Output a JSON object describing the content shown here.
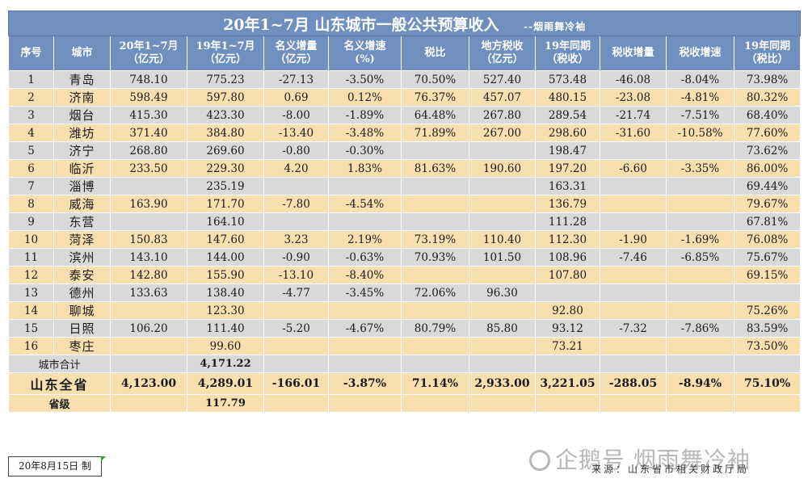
{
  "title": "20年1~7月  山东城市一般公共预算收入",
  "title_sub": "--烟雨舞冷袖",
  "headers": [
    "序号",
    "城市",
    "20年1~7月\n（亿元）",
    "19年1~7月\n（亿元）",
    "名义增量\n（亿元）",
    "名义增速\n(%)",
    "税比",
    "地方税收\n（亿元）",
    "19年同期\n（税收）",
    "税收增量",
    "税收增速",
    "19年同期\n（税比）"
  ],
  "rows": [
    {
      "no": "1",
      "city": "青岛",
      "v20": "748.10",
      "v19": "775.23",
      "inc": "-27.13",
      "rate": "-3.50%",
      "taxr": "70.50%",
      "tax": "527.40",
      "tax19": "573.48",
      "taxinc": "-46.08",
      "taxrate": "-8.04%",
      "taxr19": "73.98%"
    },
    {
      "no": "2",
      "city": "济南",
      "v20": "598.49",
      "v19": "597.80",
      "inc": "0.69",
      "rate": "0.12%",
      "taxr": "76.37%",
      "tax": "457.07",
      "tax19": "480.15",
      "taxinc": "-23.08",
      "taxrate": "-4.81%",
      "taxr19": "80.32%"
    },
    {
      "no": "3",
      "city": "烟台",
      "v20": "415.30",
      "v19": "423.30",
      "inc": "-8.00",
      "rate": "-1.89%",
      "taxr": "64.48%",
      "tax": "267.80",
      "tax19": "289.54",
      "taxinc": "-21.74",
      "taxrate": "-7.51%",
      "taxr19": "68.40%"
    },
    {
      "no": "4",
      "city": "潍坊",
      "v20": "371.40",
      "v19": "384.80",
      "inc": "-13.40",
      "rate": "-3.48%",
      "taxr": "71.89%",
      "tax": "267.00",
      "tax19": "298.60",
      "taxinc": "-31.60",
      "taxrate": "-10.58%",
      "taxr19": "77.60%"
    },
    {
      "no": "5",
      "city": "济宁",
      "v20": "268.80",
      "v19": "269.60",
      "inc": "-0.80",
      "rate": "-0.30%",
      "taxr": "",
      "tax": "",
      "tax19": "198.47",
      "taxinc": "",
      "taxrate": "",
      "taxr19": "73.62%"
    },
    {
      "no": "6",
      "city": "临沂",
      "v20": "233.50",
      "v19": "229.30",
      "inc": "4.20",
      "rate": "1.83%",
      "taxr": "81.63%",
      "tax": "190.60",
      "tax19": "197.20",
      "taxinc": "-6.60",
      "taxrate": "-3.35%",
      "taxr19": "86.00%"
    },
    {
      "no": "7",
      "city": "淄博",
      "v20": "",
      "v19": "235.19",
      "inc": "",
      "rate": "",
      "taxr": "",
      "tax": "",
      "tax19": "163.31",
      "taxinc": "",
      "taxrate": "",
      "taxr19": "69.44%"
    },
    {
      "no": "8",
      "city": "威海",
      "v20": "163.90",
      "v19": "171.70",
      "inc": "-7.80",
      "rate": "-4.54%",
      "taxr": "",
      "tax": "",
      "tax19": "136.79",
      "taxinc": "",
      "taxrate": "",
      "taxr19": "79.67%"
    },
    {
      "no": "9",
      "city": "东营",
      "v20": "",
      "v19": "164.10",
      "inc": "",
      "rate": "",
      "taxr": "",
      "tax": "",
      "tax19": "111.28",
      "taxinc": "",
      "taxrate": "",
      "taxr19": "67.81%"
    },
    {
      "no": "10",
      "city": "菏泽",
      "v20": "150.83",
      "v19": "147.60",
      "inc": "3.23",
      "rate": "2.19%",
      "taxr": "73.19%",
      "tax": "110.40",
      "tax19": "112.30",
      "taxinc": "-1.90",
      "taxrate": "-1.69%",
      "taxr19": "76.08%"
    },
    {
      "no": "11",
      "city": "滨州",
      "v20": "143.10",
      "v19": "144.00",
      "inc": "-0.90",
      "rate": "-0.63%",
      "taxr": "70.93%",
      "tax": "101.50",
      "tax19": "108.96",
      "taxinc": "-7.46",
      "taxrate": "-6.85%",
      "taxr19": "75.67%"
    },
    {
      "no": "12",
      "city": "泰安",
      "v20": "142.80",
      "v19": "155.90",
      "inc": "-13.10",
      "rate": "-8.40%",
      "taxr": "",
      "tax": "",
      "tax19": "107.80",
      "taxinc": "",
      "taxrate": "",
      "taxr19": "69.15%"
    },
    {
      "no": "13",
      "city": "德州",
      "v20": "133.63",
      "v19": "138.40",
      "inc": "-4.77",
      "rate": "-3.45%",
      "taxr": "72.06%",
      "tax": "96.30",
      "tax19": "",
      "taxinc": "",
      "taxrate": "",
      "taxr19": ""
    },
    {
      "no": "14",
      "city": "聊城",
      "v20": "",
      "v19": "123.30",
      "inc": "",
      "rate": "",
      "taxr": "",
      "tax": "",
      "tax19": "92.80",
      "taxinc": "",
      "taxrate": "",
      "taxr19": "75.26%"
    },
    {
      "no": "15",
      "city": "日照",
      "v20": "106.20",
      "v19": "111.40",
      "inc": "-5.20",
      "rate": "-4.67%",
      "taxr": "80.79%",
      "tax": "85.80",
      "tax19": "93.12",
      "taxinc": "-7.32",
      "taxrate": "-7.86%",
      "taxr19": "83.59%"
    },
    {
      "no": "16",
      "city": "枣庄",
      "v20": "",
      "v19": "99.60",
      "inc": "",
      "rate": "",
      "taxr": "",
      "tax": "",
      "tax19": "73.21",
      "taxinc": "",
      "taxrate": "",
      "taxr19": "73.50%"
    }
  ],
  "total": {
    "label": "城市合计",
    "v19": "4,171.22"
  },
  "province": {
    "label": "山东全省",
    "v20": "4,123.00",
    "v19": "4,289.01",
    "inc": "-166.01",
    "rate": "-3.87%",
    "taxr": "71.14%",
    "tax": "2,933.00",
    "tax19": "3,221.05",
    "taxinc": "-288.05",
    "taxrate": "-8.94%",
    "taxr19": "75.10%"
  },
  "level": {
    "label": "省级",
    "v19": "117.79"
  },
  "date_note": "20年8月15日 制",
  "source": "来源：山东省市相关财政厅局",
  "watermark": "企鹅号 烟雨舞冷袖",
  "colors": {
    "header": "#6f8fbe",
    "gray_row": "#d9d9d9",
    "tan_row": "#f8dfaf",
    "corner": "#2e9d2e"
  }
}
